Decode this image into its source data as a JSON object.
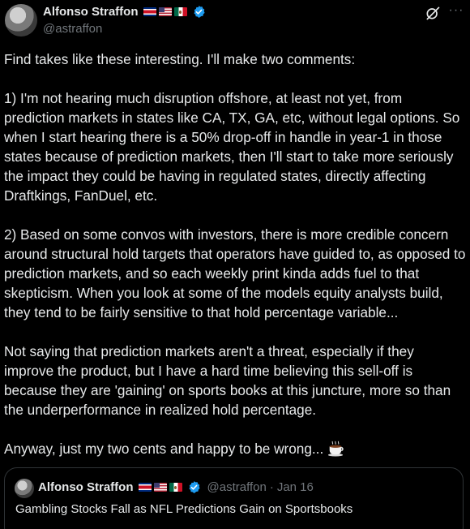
{
  "author": {
    "display_name": "Alfonso Straffon",
    "handle": "@astraffon",
    "flags": [
      "costa-rica-flag",
      "usa-flag",
      "mexico-flag"
    ],
    "verified": true
  },
  "header_actions": {
    "grok_icon": "grok-icon",
    "more_icon": "more-options-icon",
    "more_glyph": "···"
  },
  "tweet": {
    "paragraphs": [
      "Find takes like these interesting. I'll make two comments:",
      "1) I'm not hearing much disruption offshore, at least not yet, from prediction markets in states like CA, TX, GA, etc, without legal options. So when I start hearing there is a 50% drop-off in handle in year-1 in those states because of prediction markets, then I'll start to take more seriously the impact they could be having in regulated states, directly affecting Draftkings, FanDuel, etc.",
      "2) Based on some convos with investors, there is more credible concern around structural hold targets that operators have guided to, as opposed to prediction markets, and so each weekly print kinda adds fuel to that skepticism. When you look at some of the models equity analysts build, they tend to be fairly sensitive to that hold percentage variable...",
      "Not saying that prediction markets aren't a threat, especially if they improve the product, but I have a hard time believing this sell-off is because they are 'gaining' on sports books at this juncture, more so than the underperformance in realized hold percentage.",
      "Anyway, just my two cents and happy to be wrong..."
    ],
    "trailing_emoji": "coffee-icon"
  },
  "quote": {
    "display_name": "Alfonso Straffon",
    "handle": "@astraffon",
    "separator": "·",
    "date": "Jan 16",
    "text": "Gambling Stocks Fall as NFL Predictions Gain on Sportsbooks"
  },
  "colors": {
    "background": "#000000",
    "text": "#e7e9ea",
    "secondary": "#71767b",
    "verified": "#1d9bf0",
    "border": "#2f3336"
  }
}
